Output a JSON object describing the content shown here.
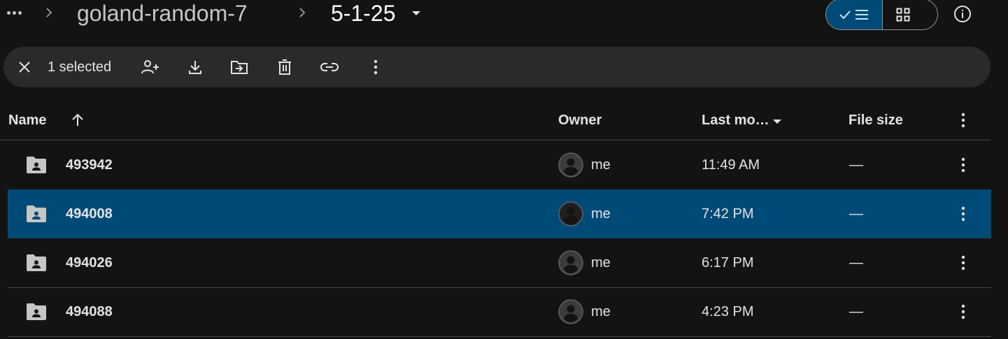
{
  "breadcrumb": {
    "more_icon": "more-horiz-icon",
    "parent": "goland-random-7",
    "current": "5-1-25"
  },
  "view_toggle": {
    "list_icon": "checked-list-icon",
    "grid_icon": "grid-view-icon",
    "active": "list"
  },
  "info_icon": "info-icon",
  "selection_bar": {
    "count_label": "1 selected",
    "actions": [
      "close-icon",
      "share-icon",
      "download-icon",
      "move-icon",
      "trash-icon",
      "link-icon",
      "more-vert-icon"
    ]
  },
  "table": {
    "columns": {
      "name": "Name",
      "owner": "Owner",
      "modified": "Last mo…",
      "size": "File size"
    },
    "sort": "ascending",
    "rows": [
      {
        "name": "493942",
        "owner": "me",
        "modified": "11:49 AM",
        "size": "—",
        "selected": false
      },
      {
        "name": "494008",
        "owner": "me",
        "modified": "7:42 PM",
        "size": "—",
        "selected": true
      },
      {
        "name": "494026",
        "owner": "me",
        "modified": "6:17 PM",
        "size": "—",
        "selected": false
      },
      {
        "name": "494088",
        "owner": "me",
        "modified": "4:23 PM",
        "size": "—",
        "selected": false
      }
    ]
  },
  "colors": {
    "background": "#131314",
    "toolbar": "#282a2c",
    "selected_row": "#004a77",
    "text": "#e3e3e3"
  }
}
